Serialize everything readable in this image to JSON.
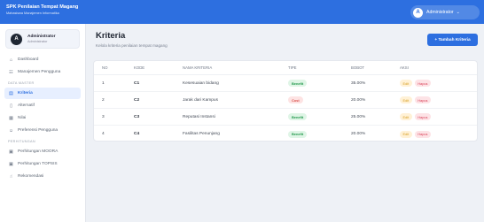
{
  "header": {
    "app_title": "SPK Penilaian Tempat Magang",
    "app_subtitle": "Mahasiswa Manajemen Informatika",
    "user_initial": "A",
    "user_name": "Administrator",
    "accent_color": "#2d6fe0"
  },
  "sidebar": {
    "profile": {
      "initial": "A",
      "name": "Administrator",
      "role": "Administrator"
    },
    "items": [
      {
        "type": "item",
        "icon": "home-icon",
        "label": "Dashboard"
      },
      {
        "type": "item",
        "icon": "users-icon",
        "label": "Manajemen Pengguna"
      },
      {
        "type": "section",
        "label": "DATA MASTER"
      },
      {
        "type": "item",
        "icon": "list-icon",
        "label": "Kriteria",
        "active": true
      },
      {
        "type": "item",
        "icon": "file-icon",
        "label": "Alternatif"
      },
      {
        "type": "item",
        "icon": "grid-icon",
        "label": "Nilai"
      },
      {
        "type": "item",
        "icon": "user-pref-icon",
        "label": "Preferensi Pengguna"
      },
      {
        "type": "section",
        "label": "PERHITUNGAN"
      },
      {
        "type": "item",
        "icon": "calculator-icon",
        "label": "Perhitungan MOORA"
      },
      {
        "type": "item",
        "icon": "calculator-icon",
        "label": "Perhitungan TOPSIS"
      },
      {
        "type": "item",
        "icon": "thumbs-up-icon",
        "label": "Rekomendasi"
      }
    ]
  },
  "main": {
    "title": "Kriteria",
    "subtitle": "Kelola kriteria penilaian tempat magang",
    "add_button_label": "+ Tambah Kriteria",
    "table": {
      "headers": {
        "no": "NO",
        "kode": "KODE",
        "nama": "NAMA KRITERIA",
        "tipe": "TIPE",
        "bobot": "BOBOT",
        "aksi": "AKSI"
      },
      "rows": [
        {
          "no": "1",
          "kode": "C1",
          "nama": "Kesesuaian bidang",
          "tipe": "Benefit",
          "bobot": "35.00%",
          "edit": "Edit",
          "hapus": "Hapus"
        },
        {
          "no": "2",
          "kode": "C2",
          "nama": "Jarak dari Kampus",
          "tipe": "Cost",
          "bobot": "20.00%",
          "edit": "Edit",
          "hapus": "Hapus"
        },
        {
          "no": "3",
          "kode": "C3",
          "nama": "Reputasi Instansi",
          "tipe": "Benefit",
          "bobot": "25.00%",
          "edit": "Edit",
          "hapus": "Hapus"
        },
        {
          "no": "4",
          "kode": "C4",
          "nama": "Fasilitas Penunjang",
          "tipe": "Benefit",
          "bobot": "20.00%",
          "edit": "Edit",
          "hapus": "Hapus"
        }
      ]
    }
  }
}
